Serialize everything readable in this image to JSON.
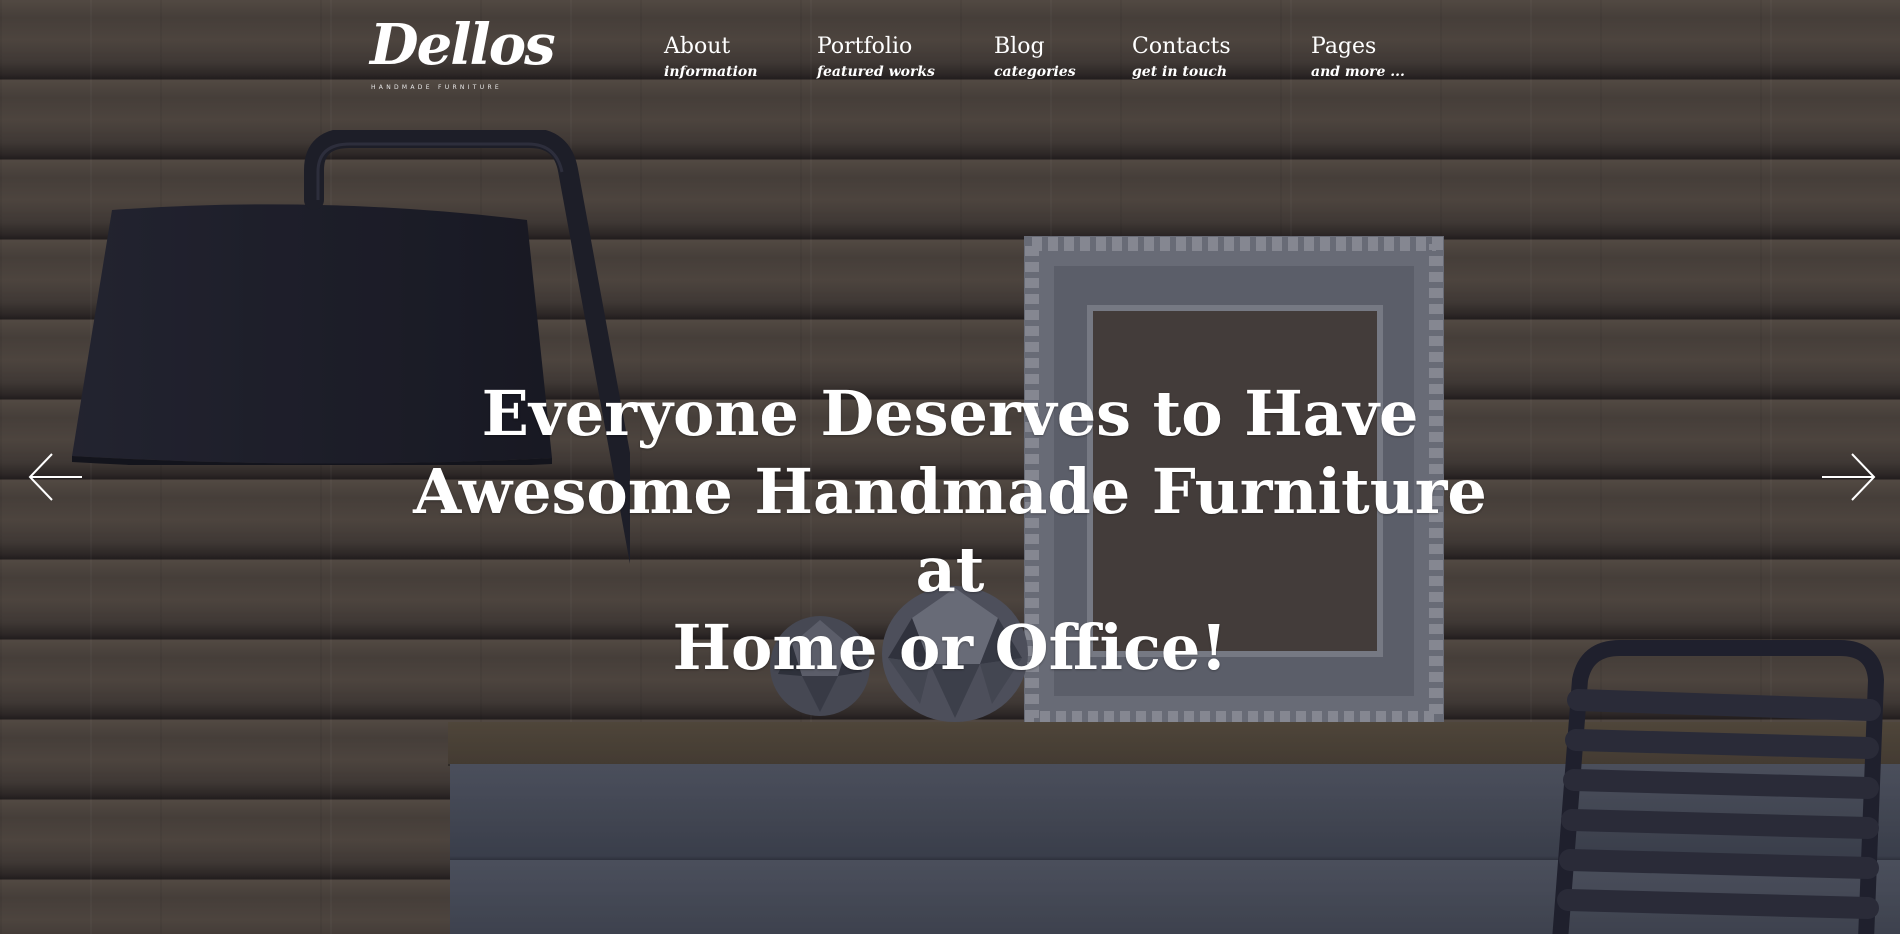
{
  "brand": {
    "name": "Dellos",
    "tagline": "HANDMADE FURNITURE"
  },
  "nav": [
    {
      "title": "About",
      "subtitle": "information"
    },
    {
      "title": "Portfolio",
      "subtitle": "featured works"
    },
    {
      "title": "Blog",
      "subtitle": "categories"
    },
    {
      "title": "Contacts",
      "subtitle": "get in touch"
    },
    {
      "title": "Pages",
      "subtitle": "and more ..."
    }
  ],
  "hero": {
    "headline_lines": [
      "Everyone Deserves to Have",
      "Awesome Handmade Furniture at",
      "Home or Office!"
    ]
  },
  "slider": {
    "prev_icon": "arrow-left-icon",
    "next_icon": "arrow-right-icon"
  },
  "colors": {
    "text": "#ffffff",
    "wood_dark": "#3a322c",
    "wood_light": "#6f6254",
    "lamp": "#22232e",
    "frame": "#a9acb6"
  }
}
